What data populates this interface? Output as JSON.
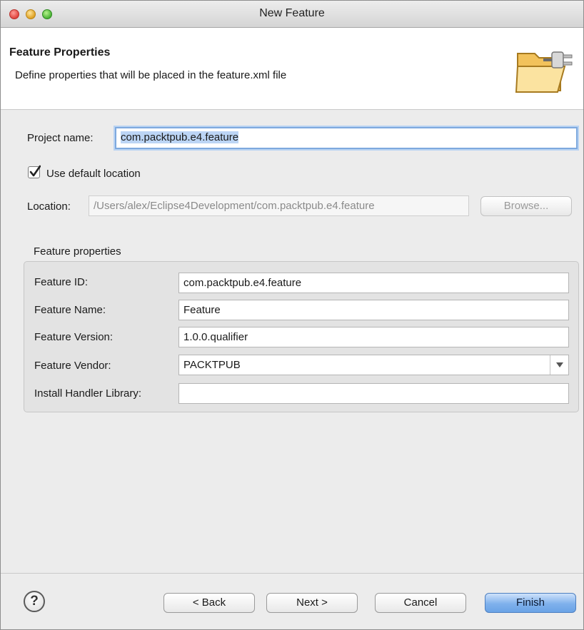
{
  "window": {
    "title": "New Feature"
  },
  "header": {
    "title": "Feature Properties",
    "description": "Define properties that will be placed in the feature.xml file",
    "icon": "folder-plug-icon"
  },
  "form": {
    "project_name_label": "Project name:",
    "project_name_value": "com.packtpub.e4.feature",
    "use_default_location_label": "Use default location",
    "use_default_location_checked": true,
    "location_label": "Location:",
    "location_value": "/Users/alex/Eclipse4Development/com.packtpub.e4.feature",
    "browse_label": "Browse..."
  },
  "feature_properties": {
    "group_label": "Feature properties",
    "id_label": "Feature ID:",
    "id_value": "com.packtpub.e4.feature",
    "name_label": "Feature Name:",
    "name_value": "Feature",
    "version_label": "Feature Version:",
    "version_value": "1.0.0.qualifier",
    "vendor_label": "Feature Vendor:",
    "vendor_value": "PACKTPUB",
    "install_handler_label": "Install Handler Library:",
    "install_handler_value": ""
  },
  "buttons": {
    "help": "?",
    "back": "< Back",
    "next": "Next >",
    "cancel": "Cancel",
    "finish": "Finish"
  },
  "colors": {
    "accent": "#6aa3e6",
    "focus_ring": "#7ea9de",
    "selection": "#bcd5f5"
  }
}
